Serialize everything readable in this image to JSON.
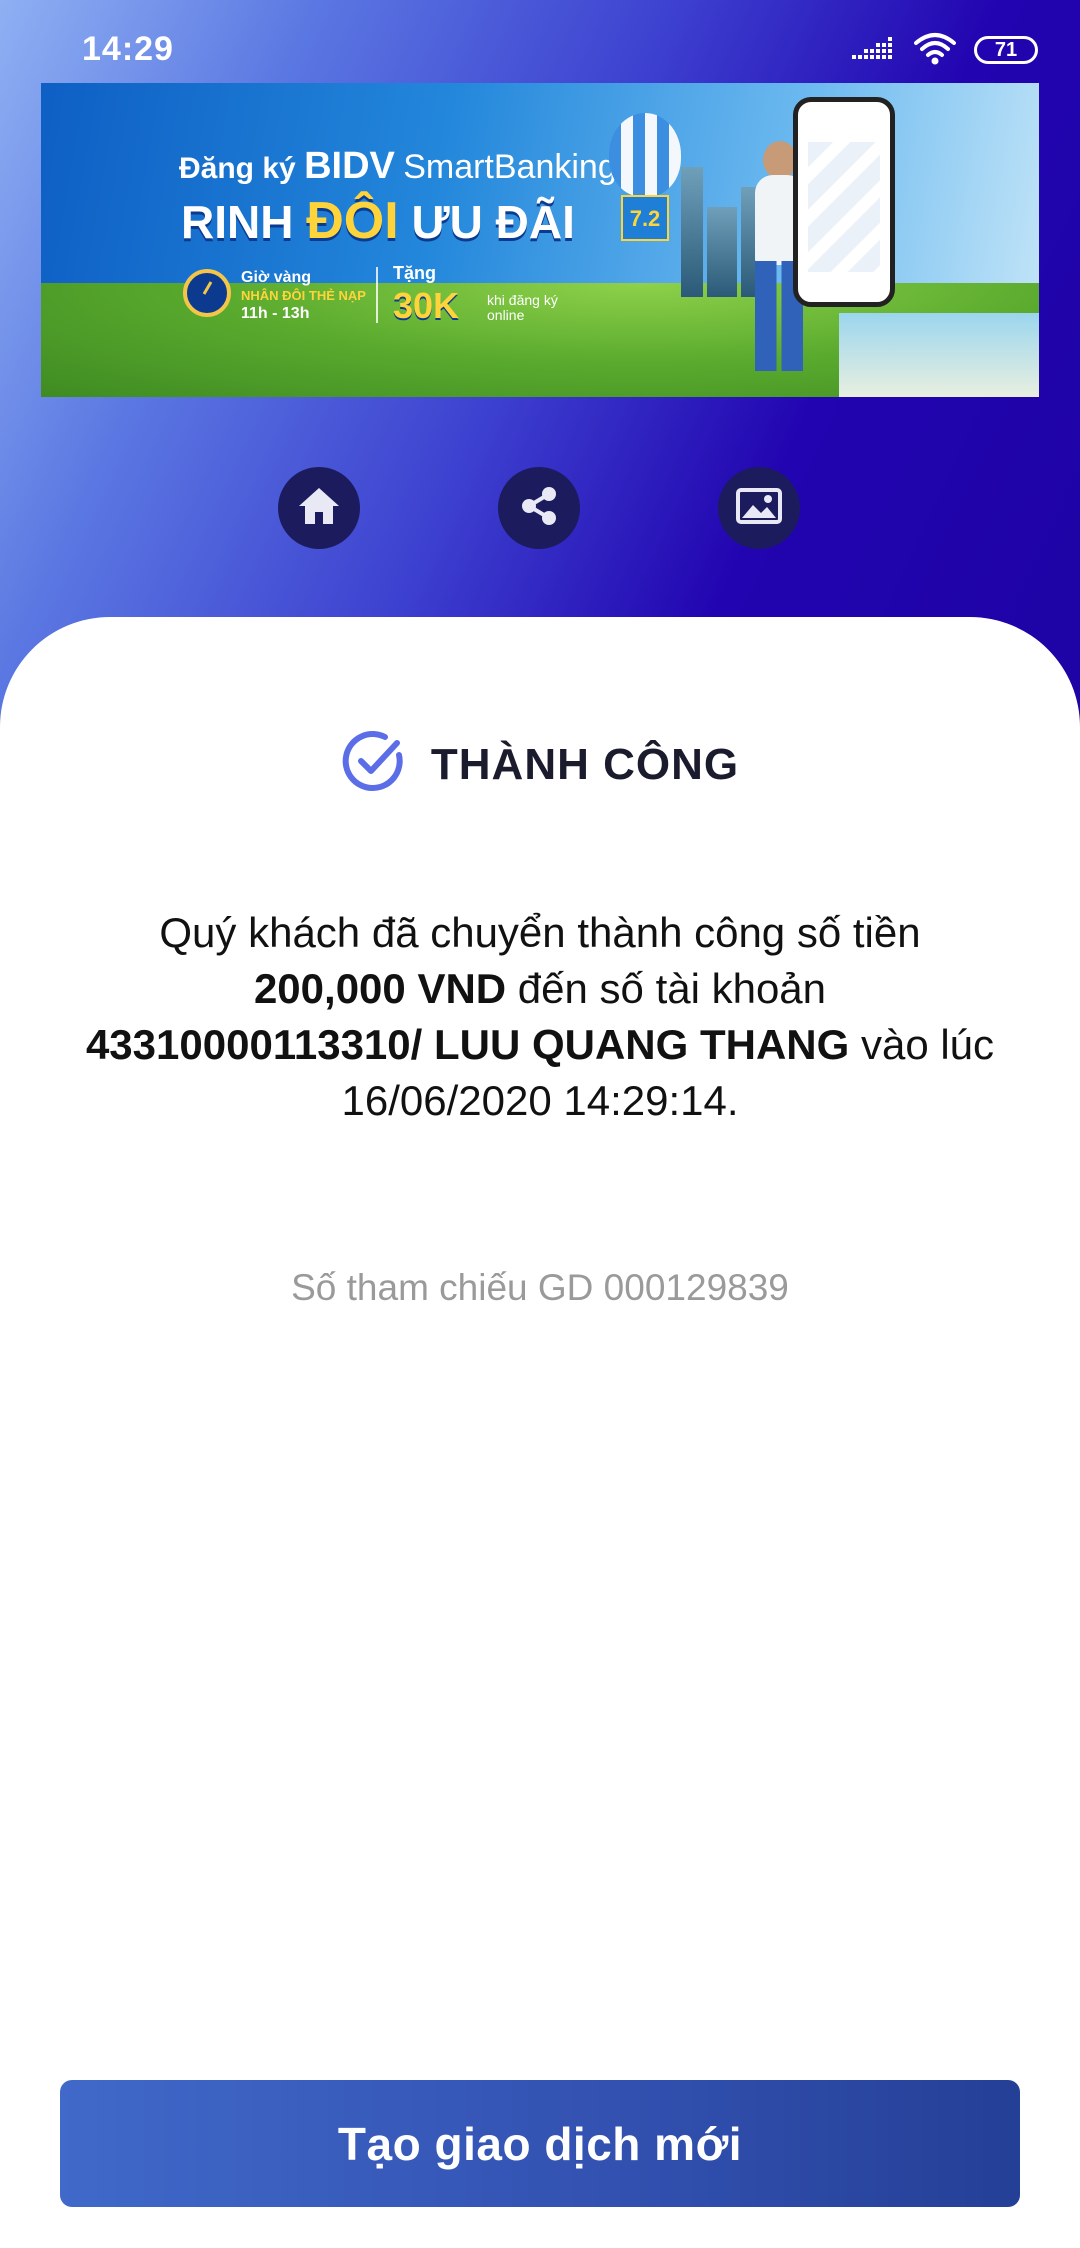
{
  "status_bar": {
    "time": "14:29",
    "battery": "71",
    "icons": [
      "signal-icon",
      "wifi-icon",
      "battery-icon"
    ]
  },
  "banner": {
    "line1_prefix": "Đăng ký",
    "line1_brand": "BIDV",
    "line1_product": "SmartBanking",
    "line2_a": "RINH ",
    "line2_b": "ĐÔI",
    "line2_c": " ƯU ĐÃI",
    "gio_vang": "Giờ vàng",
    "nhan_doi": "NHÂN ĐÔI THẺ NẠP",
    "hours": "11h - 13h",
    "tang": "Tặng",
    "amount": "30K",
    "khi_dang_ky": "khi đăng ký",
    "online": "online",
    "badge": "7.2"
  },
  "actions": [
    {
      "name": "home-icon"
    },
    {
      "name": "share-icon"
    },
    {
      "name": "image-icon"
    }
  ],
  "result": {
    "title": "THÀNH CÔNG",
    "msg_part1": "Quý khách đã chuyển thành công số tiền ",
    "amount": "200,000 VND",
    "msg_part2": " đến số tài khoản ",
    "account": "43310000113310/ LUU QUANG THANG",
    "msg_part3": " vào lúc 16/06/2020 14:29:14.",
    "reference": "Số tham chiếu GD 000129839"
  },
  "button": {
    "new_transaction": "Tạo giao dịch mới"
  },
  "colors": {
    "header_gradient_start": "#8fb0f3",
    "header_gradient_end": "#1d03a4",
    "action_button_bg": "#1c1b5e",
    "check_icon": "#5b6ee8",
    "primary_button": "#3352b2"
  }
}
